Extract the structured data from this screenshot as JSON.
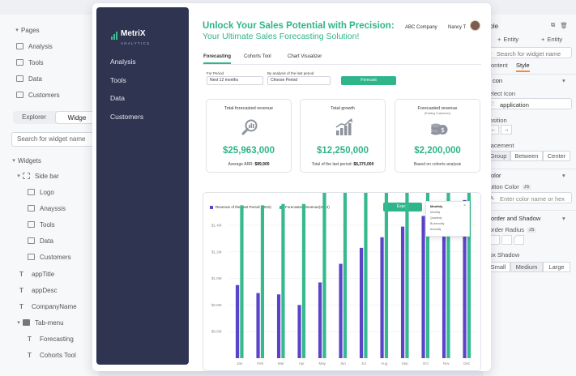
{
  "left_panel": {
    "pages_header": "Pages",
    "pages": [
      "Analysis",
      "Tools",
      "Data",
      "Customers"
    ],
    "tabs": [
      "Explorer",
      "Widge"
    ],
    "search_placeholder": "Search for widget name",
    "widgets_header": "Widgets",
    "tree": [
      {
        "label": "Side bar",
        "icon": "dashed-box-icon",
        "chevron": "▾"
      },
      {
        "label": "Logo",
        "icon": "image-icon"
      },
      {
        "label": "Anayssis",
        "icon": "box-icon"
      },
      {
        "label": "Tools",
        "icon": "box-icon"
      },
      {
        "label": "Data",
        "icon": "box-icon"
      },
      {
        "label": "Customers",
        "icon": "box-icon"
      },
      {
        "label": "appTitle",
        "icon": "text-icon"
      },
      {
        "label": "appDesc",
        "icon": "text-icon"
      },
      {
        "label": "CompanyName",
        "icon": "text-icon"
      },
      {
        "label": "Tab-menu",
        "icon": "folder-icon",
        "chevron": "▾"
      },
      {
        "label": "Forecasting",
        "icon": "text-icon"
      },
      {
        "label": "Cohorts Tool",
        "icon": "text-icon"
      }
    ]
  },
  "right_panel": {
    "title_fragment": "able",
    "entity_1": "Entity",
    "entity_2": "Entity",
    "search_placeholder": "Search for widget name",
    "tab_content": "ontent",
    "tab_style": "Style",
    "section_icon": "con",
    "select_icon_label": "elect Icon",
    "select_icon_value": "application",
    "position_label": "osition",
    "placement_label": "lacement",
    "placement_options": [
      "Group",
      "Between",
      "Center"
    ],
    "color_section": "olor",
    "button_color_label": "utton Color",
    "js_badge": "JS",
    "color_placeholder": "Enter color name or hex",
    "border_section": "order and Shadow",
    "border_radius_label": "order Radius",
    "shadow_label": "ox Shadow",
    "shadow_options": [
      "Small",
      "Medium",
      "Large"
    ]
  },
  "app": {
    "logo_text": "MetriX",
    "logo_sub": "ANALYTICS",
    "nav": [
      "Analysis",
      "Tools",
      "Data",
      "Customers"
    ],
    "hero_title": "Unlock Your Sales Potential with Precision:",
    "hero_subtitle": "Your Ultimate Sales Forecasting Solution!",
    "company": "ABC Company",
    "user": "Nancy T",
    "tabs": [
      "Forecasting",
      "Cohorts Tool",
      "Chart Visualizer"
    ],
    "for_period_label": "For Period",
    "for_period_value": "Next 12 months",
    "analysis_label": "By analysis of the last period",
    "analysis_value": "Choose Period",
    "forecast_btn": "Forecast",
    "cards": [
      {
        "title": "Total forecasted revenue",
        "note": "",
        "value": "$25,963,000",
        "foot_label": "Average ARR:",
        "foot_value": "$89,900",
        "icon": "magnifier-chart-icon"
      },
      {
        "title": "Total growth",
        "note": "",
        "value": "$12,250,000",
        "foot_label": "Total of the last period:",
        "foot_value": "$8,370,000",
        "icon": "growth-bars-icon"
      },
      {
        "title": "Forecasted revenue",
        "note": "(Existing Customers)",
        "value": "$2,200,000",
        "foot_label": "Based on cohorts analysis",
        "foot_value": "",
        "icon": "coins-icon"
      }
    ],
    "export_btn": "Export",
    "dropdown": {
      "title": "Monthly",
      "options": [
        "Monthly",
        "Quarterly",
        "Bi-annually",
        "Annually"
      ]
    }
  },
  "colors": {
    "accent": "#2fb58a",
    "sidebar": "#2f3451",
    "series_prev": "#5b44c9",
    "series_fore": "#37b98f"
  },
  "chart_data": {
    "type": "bar",
    "categories": [
      "Jan",
      "Feb",
      "Mar",
      "Apr",
      "May",
      "Jun",
      "Jul",
      "Aug",
      "Sep",
      "Oct",
      "Nov",
      "Dec"
    ],
    "series": [
      {
        "name": "Revenue of the Last Period (2022)",
        "values": [
          0.95,
          0.89,
          0.88,
          0.8,
          0.97,
          1.11,
          1.23,
          1.31,
          1.39,
          1.47,
          1.53,
          1.59
        ]
      },
      {
        "name": "Forecasted Revenue(2024)",
        "values": [
          1.55,
          1.55,
          1.56,
          1.56,
          1.66,
          1.77,
          1.9,
          1.9,
          2.05,
          2.07,
          2.17,
          2.16
        ]
      }
    ],
    "yticks": [
      "$1.4M",
      "$1.2M",
      "$1.0M",
      "$0.8M",
      "$0.6M"
    ],
    "ylim": [
      0.4,
      1.4
    ],
    "grid": true,
    "legend": "top-left"
  }
}
